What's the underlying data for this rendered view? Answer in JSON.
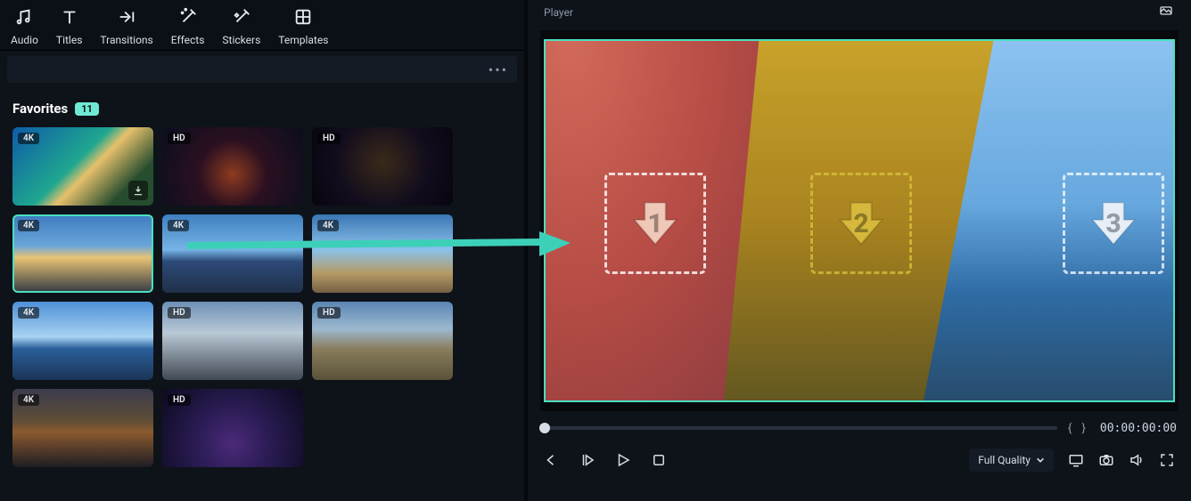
{
  "tabs": [
    {
      "id": "audio",
      "label": "Audio",
      "icon": "audio-icon"
    },
    {
      "id": "titles",
      "label": "Titles",
      "icon": "titles-icon"
    },
    {
      "id": "transitions",
      "label": "Transitions",
      "icon": "transitions-icon"
    },
    {
      "id": "effects",
      "label": "Effects",
      "icon": "effects-icon"
    },
    {
      "id": "stickers",
      "label": "Stickers",
      "icon": "stickers-icon"
    },
    {
      "id": "templates",
      "label": "Templates",
      "icon": "templates-icon"
    }
  ],
  "library": {
    "section": "Favorites",
    "count": "11",
    "thumbs": [
      {
        "res": "4K",
        "klass": "th1",
        "selected": false,
        "download": true
      },
      {
        "res": "HD",
        "klass": "th2",
        "selected": false,
        "download": false
      },
      {
        "res": "HD",
        "klass": "th3",
        "selected": false,
        "download": false
      },
      {
        "res": "4K",
        "klass": "th4",
        "selected": true,
        "download": false
      },
      {
        "res": "4K",
        "klass": "th5",
        "selected": false,
        "download": false
      },
      {
        "res": "4K",
        "klass": "th6",
        "selected": false,
        "download": false
      },
      {
        "res": "4K",
        "klass": "th7",
        "selected": false,
        "download": false
      },
      {
        "res": "HD",
        "klass": "th8",
        "selected": false,
        "download": false
      },
      {
        "res": "HD",
        "klass": "th9",
        "selected": false,
        "download": false
      },
      {
        "res": "4K",
        "klass": "th10",
        "selected": false,
        "download": false
      },
      {
        "res": "HD",
        "klass": "th11",
        "selected": false,
        "download": false
      }
    ]
  },
  "player": {
    "title": "Player",
    "dropzones": [
      {
        "num": "1",
        "fill": "#f0c8b8",
        "stroke": "rgba(255,255,255,0.85)"
      },
      {
        "num": "2",
        "fill": "#d6b83c",
        "stroke": "rgba(222,200,60,0.8)"
      },
      {
        "num": "3",
        "fill": "#e6eff8",
        "stroke": "rgba(255,255,255,0.85)"
      }
    ],
    "quality": "Full Quality",
    "timecode": "00:00:00:00",
    "braces": "{    }"
  },
  "colors": {
    "teal": "#3dd0b8",
    "accent": "#ffae1a"
  }
}
